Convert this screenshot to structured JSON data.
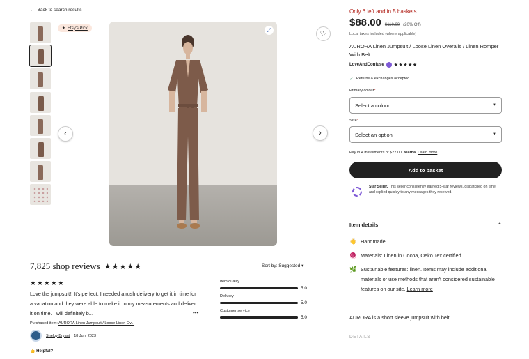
{
  "nav": {
    "back_label": "Back to search results",
    "back_icon": "arrow-left-icon"
  },
  "gallery": {
    "thumbnail_count": 8,
    "active_index": 1,
    "badge_label": "Etsy's Pick",
    "zoom_icon": "zoom-icon",
    "favorite_icon": "heart-icon",
    "prev_icon": "chevron-left-icon",
    "next_icon": "chevron-right-icon"
  },
  "reviews": {
    "title": "7,825 shop reviews",
    "stars": "★★★★★",
    "sort_label": "Sort by: Suggested",
    "review_stars": "★★★★★",
    "review_text": "Love the jumpsuit!! It's perfect. I needed a rush delivery to get it in time for a vacation and they were able to make it to my measurements and deliver it on time. I will definitely b...",
    "more_label": "•••",
    "purchased_label": "Purchased item:",
    "purchased_item": "AURORA Linen Jumpsuit / Loose Linen Ov...",
    "reviewer_name": "Shelby Bryant",
    "review_date": "18 Jun, 2023",
    "helpful_label": "Helpful?",
    "ratings": [
      {
        "label": "Item quality",
        "score": "5.0",
        "value": 5.0
      },
      {
        "label": "Delivery",
        "score": "5.0",
        "value": 5.0
      },
      {
        "label": "Customer service",
        "score": "5.0",
        "value": 5.0
      }
    ]
  },
  "product": {
    "stock": "Only 6 left and in 5 baskets",
    "price": "$88.00",
    "original_price": "$110.00",
    "discount": "(20% Off)",
    "taxes_note": "Local taxes included (where applicable)",
    "title": "AURORA Linen Jumpsuit / Loose Linen Overalls / Linen Romper With Belt",
    "shop_name": "LoveAndConfuse",
    "shop_stars": "★★★★★",
    "returns": "Returns & exchanges accepted",
    "colour_label": "Primary colour",
    "colour_placeholder": "Select a colour",
    "size_label": "Size",
    "size_placeholder": "Select an option",
    "required_mark": "*",
    "installments_text": "Pay in 4 installments of $22.00.",
    "installments_provider": "Klarna.",
    "installments_link": "Learn more",
    "add_to_basket": "Add to basket",
    "star_seller_title": "Star Seller.",
    "star_seller_text": "This seller consistently earned 5-star reviews, dispatched on time, and replied quickly to any messages they received.",
    "item_details_label": "Item details",
    "details": [
      {
        "icon": "hand-wave-icon",
        "glyph": "👋",
        "text": "Handmade"
      },
      {
        "icon": "fabric-icon",
        "glyph": "🧶",
        "text": "Materials: Linen in Cocoa, Oeko Tex certified"
      },
      {
        "icon": "leaf-icon",
        "glyph": "🌿",
        "text": "Sustainable features: linen. Items may include additional materials or use methods that aren't considered sustainable features on our site.",
        "link": "Learn more"
      }
    ],
    "description": "AURORA is a short sleeve jumpsuit with belt.",
    "details_heading": "DETAILS"
  },
  "colors": {
    "accent_red": "#b3261e",
    "button_dark": "#222222",
    "star_seller_purple": "#7f5ad6",
    "badge_bg": "#fbe7dd"
  }
}
